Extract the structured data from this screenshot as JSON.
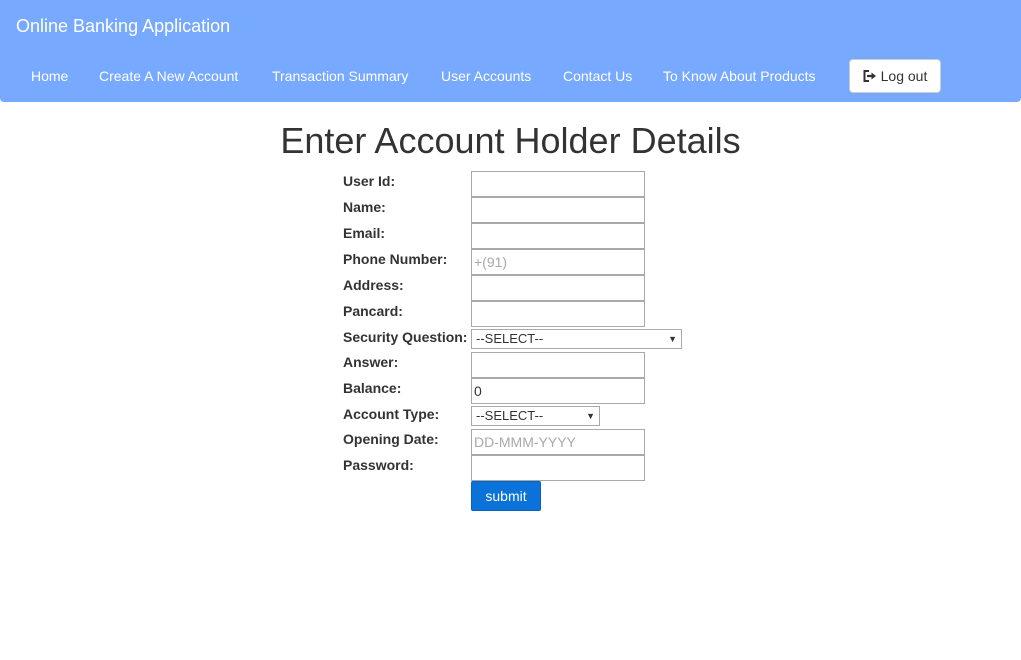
{
  "header": {
    "brand": "Online Banking Application",
    "nav": [
      {
        "label": "Home"
      },
      {
        "label": "Create A New Account"
      },
      {
        "label": "Transaction Summary"
      },
      {
        "label": "User Accounts"
      },
      {
        "label": "Contact Us"
      },
      {
        "label": "To Know About Products"
      }
    ],
    "logout_label": "Log out",
    "logout_icon": "logout-icon"
  },
  "form": {
    "title": "Enter Account Holder Details",
    "fields": {
      "user_id": {
        "label": "User Id:",
        "value": "",
        "placeholder": ""
      },
      "name": {
        "label": "Name:",
        "value": "",
        "placeholder": ""
      },
      "email": {
        "label": "Email:",
        "value": "",
        "placeholder": ""
      },
      "phone": {
        "label": "Phone Number:",
        "value": "",
        "placeholder": "+(91)"
      },
      "address": {
        "label": "Address:",
        "value": "",
        "placeholder": ""
      },
      "pancard": {
        "label": "Pancard:",
        "value": "",
        "placeholder": ""
      },
      "security_question": {
        "label": "Security Question:",
        "selected": "--SELECT--"
      },
      "answer": {
        "label": "Answer:",
        "value": "",
        "placeholder": ""
      },
      "balance": {
        "label": "Balance:",
        "value": "0",
        "placeholder": ""
      },
      "account_type": {
        "label": "Account Type:",
        "selected": "--SELECT--"
      },
      "opening_date": {
        "label": "Opening Date:",
        "value": "",
        "placeholder": "DD-MMM-YYYY"
      },
      "password": {
        "label": "Password:",
        "value": "",
        "placeholder": ""
      }
    },
    "submit_label": "submit"
  },
  "colors": {
    "navbar": "#77a9ff",
    "submit": "#0a72d9"
  }
}
